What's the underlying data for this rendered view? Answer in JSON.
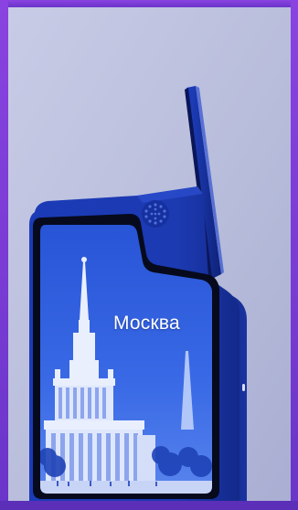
{
  "screen": {
    "city_label": "Москва"
  },
  "colors": {
    "frame_purple": "#7d3fd6",
    "background": "#b6bbd9",
    "kiosk_blue": "#1a37b5",
    "screen_sky": "#2f5be0"
  },
  "icons": {
    "grille": "speaker-grille-icon",
    "indicator": "status-led-icon"
  }
}
